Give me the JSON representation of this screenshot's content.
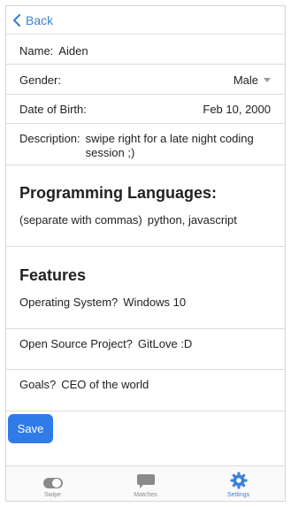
{
  "nav": {
    "back_label": "Back"
  },
  "profile": {
    "name_label": "Name:",
    "name_value": "Aiden",
    "gender_label": "Gender:",
    "gender_value": "Male",
    "dob_label": "Date of Birth:",
    "dob_value": "Feb 10, 2000",
    "description_label": "Description:",
    "description_value": "swipe right for a late night coding session ;)"
  },
  "languages": {
    "heading": "Programming Languages:",
    "label": "(separate with commas)",
    "value": "python, javascript"
  },
  "features": {
    "heading": "Features",
    "os_label": "Operating System?",
    "os_value": "Windows 10",
    "oss_label": "Open Source Project?",
    "oss_value": "GitLove :D",
    "goals_label": "Goals?",
    "goals_value": "CEO of the world"
  },
  "save_label": "Save",
  "tabs": [
    {
      "label": "Swipe",
      "icon": "toggle-icon"
    },
    {
      "label": "Matches",
      "icon": "chat-bubble-icon"
    },
    {
      "label": "Settings",
      "icon": "gear-icon",
      "active": true
    }
  ],
  "colors": {
    "accent": "#3b82d6",
    "save_button": "#2f7bea"
  }
}
